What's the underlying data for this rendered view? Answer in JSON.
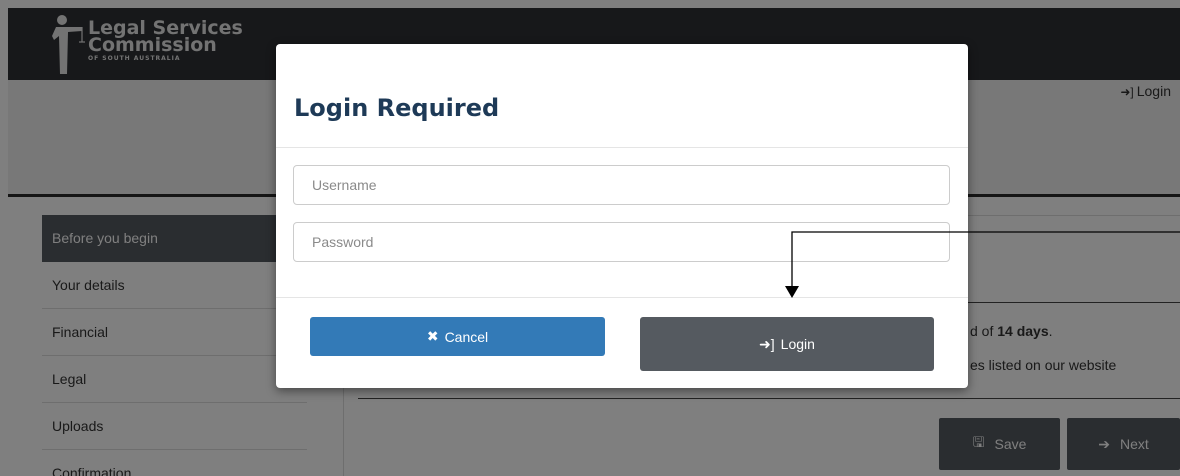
{
  "header": {
    "logo_line1": "Legal Services",
    "logo_line2": "Commission",
    "logo_line3": "OF SOUTH AUSTRALIA",
    "login_link": "Login"
  },
  "sidebar": {
    "items": [
      {
        "label": "Before you begin",
        "active": true
      },
      {
        "label": "Your details"
      },
      {
        "label": "Financial"
      },
      {
        "label": "Legal"
      },
      {
        "label": "Uploads"
      },
      {
        "label": "Confirmation"
      }
    ]
  },
  "content": {
    "text1_prefix": "d of ",
    "text1_bold": "14 days",
    "text1_suffix": ".",
    "text2": "es listed on our website",
    "save_label": "Save",
    "next_label": "Next"
  },
  "modal": {
    "title": "Login Required",
    "username_placeholder": "Username",
    "password_placeholder": "Password",
    "cancel_label": "Cancel",
    "login_label": "Login"
  },
  "colors": {
    "header_bg": "#2f3134",
    "primary": "#337ab7",
    "dark_button": "#555a60",
    "title": "#1e3a57"
  },
  "icons": {
    "login": "sign-in-icon",
    "cancel": "times-icon",
    "save": "floppy-disk-icon",
    "next": "circle-arrow-right-icon"
  }
}
